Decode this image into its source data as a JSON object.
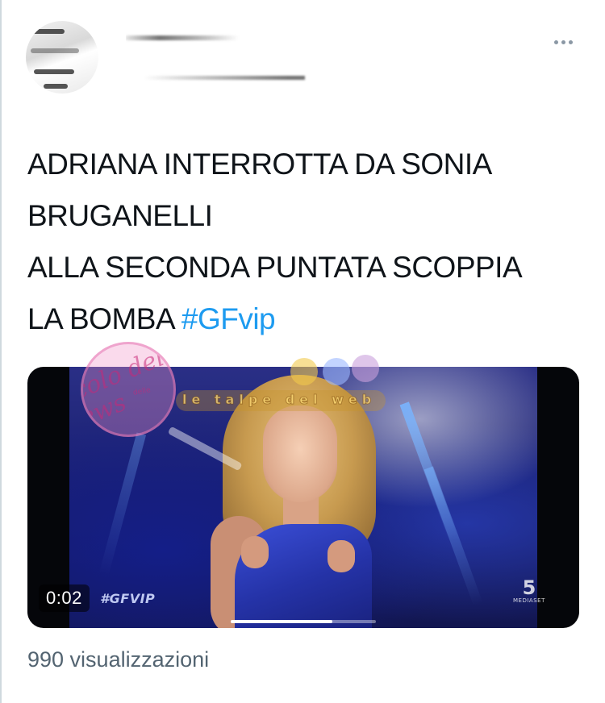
{
  "tweet": {
    "author": {
      "avatar_icon": "avatar-icon",
      "name_redacted": true,
      "handle_redacted": true
    },
    "more_icon": "more-horizontal-icon",
    "text_lines": [
      "ADRIANA INTERROTTA DA SONIA",
      "BRUGANELLI",
      "ALLA SECONDA PUNTATA SCOPPIA",
      "LA BOMBA "
    ],
    "hashtag": "#GFvip",
    "colors": {
      "text": "#0f1419",
      "link": "#1d9bf0",
      "secondary": "#536471"
    }
  },
  "video": {
    "elapsed": "0:02",
    "channel_tag": "#GFVIP",
    "network_logo": "5",
    "network_logo_sub": "MEDIASET",
    "progress_fraction": 0.7
  },
  "watermarks": {
    "circle_script": "Vicolo delle News",
    "circle_small": "delle",
    "banner": "le talpe del web"
  },
  "stats": {
    "views": "990 visualizzazioni"
  }
}
